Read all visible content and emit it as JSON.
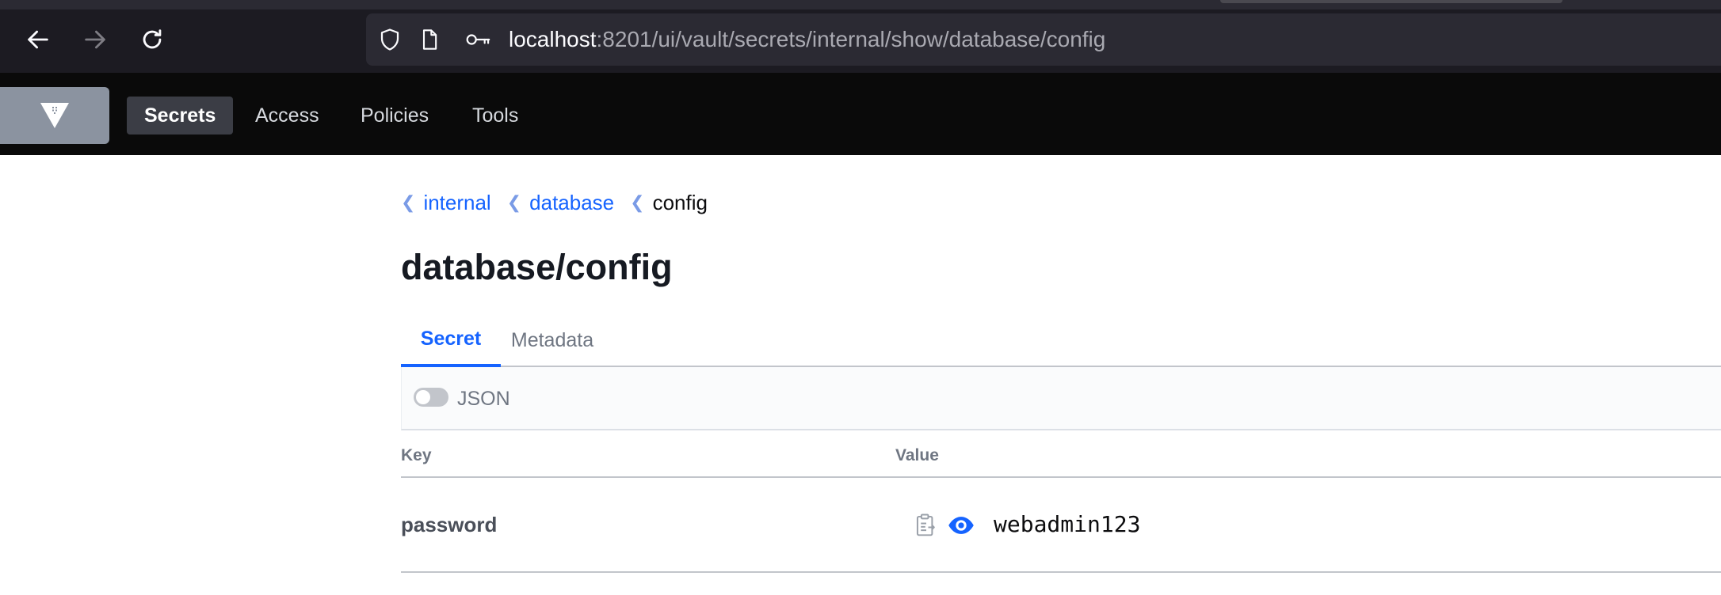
{
  "browser": {
    "url_host": "localhost",
    "url_rest": ":8201/ui/vault/secrets/internal/show/database/config"
  },
  "nav": {
    "items": [
      {
        "label": "Secrets",
        "active": true
      },
      {
        "label": "Access",
        "active": false
      },
      {
        "label": "Policies",
        "active": false
      },
      {
        "label": "Tools",
        "active": false
      }
    ]
  },
  "breadcrumb": {
    "items": [
      "internal",
      "database"
    ],
    "current": "config"
  },
  "page": {
    "title": "database/config"
  },
  "tabs": [
    {
      "label": "Secret",
      "active": true
    },
    {
      "label": "Metadata",
      "active": false
    }
  ],
  "toolbar": {
    "json_toggle_label": "JSON",
    "json_toggle_on": false
  },
  "table": {
    "columns": [
      "Key",
      "Value"
    ],
    "rows": [
      {
        "key": "password",
        "value": "webadmin123"
      }
    ]
  },
  "colors": {
    "accent": "#1563ff",
    "header_bg": "#0a0a0a"
  }
}
